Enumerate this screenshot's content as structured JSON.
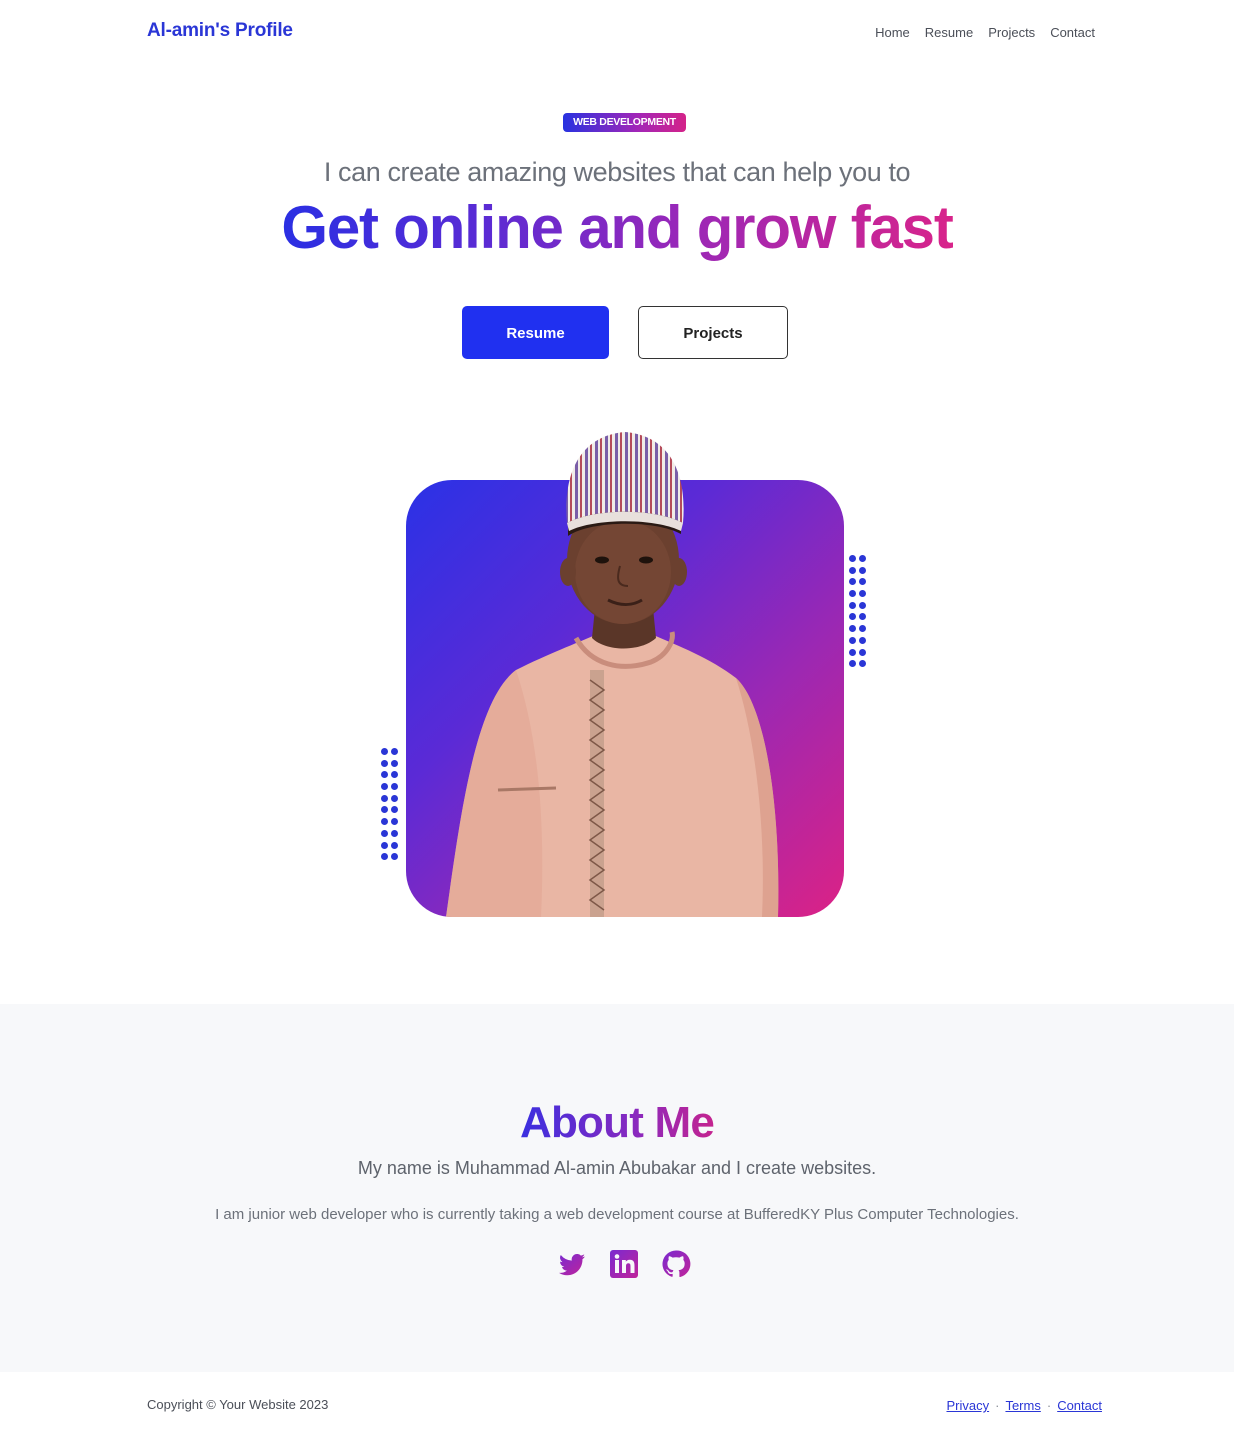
{
  "navbar": {
    "brand": "Al-amin's Profile",
    "links": [
      "Home",
      "Resume",
      "Projects",
      "Contact"
    ]
  },
  "hero": {
    "badge": "WEB DEVELOPMENT",
    "subtitle": "I can create amazing websites that can help you to",
    "title": "Get online and grow fast",
    "buttons": {
      "primary": "Resume",
      "secondary": "Projects"
    }
  },
  "profile": {
    "image": "portrait-photo",
    "gradient": [
      "#2a32e6",
      "#dc2285"
    ]
  },
  "about": {
    "title": "About Me",
    "lead": "My name is Muhammad Al-amin Abubakar and I create websites.",
    "text": "I am junior web developer who is currently taking a web development course at BufferedKY Plus Computer Technologies.",
    "socials": [
      "twitter-icon",
      "linkedin-icon",
      "github-icon"
    ]
  },
  "footer": {
    "copyright": "Copyright © Your Website 2023",
    "links": [
      "Privacy",
      "Terms",
      "Contact"
    ],
    "separator": "·"
  },
  "colors": {
    "brand": "#2a36d6",
    "primary_button": "#2030f0",
    "accent_pink": "#d8248a",
    "about_bg": "#f7f8fa"
  }
}
